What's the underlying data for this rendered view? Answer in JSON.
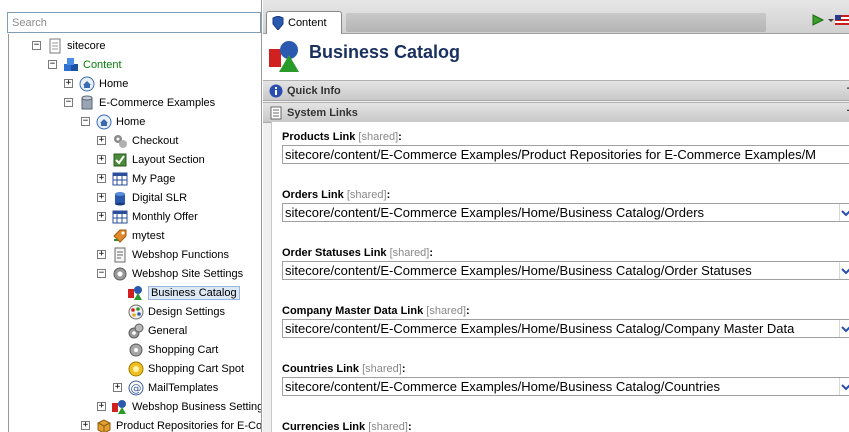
{
  "search": {
    "placeholder": "Search"
  },
  "tree": [
    {
      "label": "sitecore",
      "expander": "−"
    },
    {
      "label": "Content",
      "expander": "−"
    },
    {
      "label": "Home",
      "expander": "+"
    },
    {
      "label": "E-Commerce Examples",
      "expander": "−"
    },
    {
      "label": "Home",
      "expander": "−"
    },
    {
      "label": "Checkout",
      "expander": "+"
    },
    {
      "label": "Layout Section",
      "expander": "+"
    },
    {
      "label": "My Page",
      "expander": "+"
    },
    {
      "label": "Digital SLR",
      "expander": "+"
    },
    {
      "label": "Monthly Offer",
      "expander": "+"
    },
    {
      "label": "mytest",
      "expander": ""
    },
    {
      "label": "Webshop Functions",
      "expander": "+"
    },
    {
      "label": "Webshop Site Settings",
      "expander": "−"
    },
    {
      "label": "Business Catalog",
      "expander": ""
    },
    {
      "label": "Design Settings",
      "expander": ""
    },
    {
      "label": "General",
      "expander": ""
    },
    {
      "label": "Shopping Cart",
      "expander": ""
    },
    {
      "label": "Shopping Cart Spot",
      "expander": ""
    },
    {
      "label": "MailTemplates",
      "expander": "+"
    },
    {
      "label": "Webshop Business Setting",
      "expander": "+"
    },
    {
      "label": "Product Repositories for E-Co",
      "expander": "+"
    }
  ],
  "tabs": {
    "content": "Content"
  },
  "page": {
    "title": "Business Catalog"
  },
  "sections": {
    "quick_info": {
      "label": "Quick Info",
      "control": "+"
    },
    "system_links": {
      "label": "System Links",
      "control": "−"
    }
  },
  "shared_tag": "[shared]",
  "fields": [
    {
      "label": "Products Link",
      "value": "sitecore/content/E-Commerce Examples/Product Repositories for E-Commerce Examples/M"
    },
    {
      "label": "Orders Link",
      "value": "sitecore/content/E-Commerce Examples/Home/Business Catalog/Orders"
    },
    {
      "label": "Order Statuses Link",
      "value": "sitecore/content/E-Commerce Examples/Home/Business Catalog/Order Statuses"
    },
    {
      "label": "Company Master Data Link",
      "value": "sitecore/content/E-Commerce Examples/Home/Business Catalog/Company Master Data"
    },
    {
      "label": "Countries Link",
      "value": "sitecore/content/E-Commerce Examples/Home/Business Catalog/Countries"
    },
    {
      "label": "Currencies Link",
      "value": ""
    }
  ],
  "colors": {
    "accent": "#1a3060",
    "selected_bg": "#dde8f5",
    "content_label": "#0a7a0a"
  }
}
